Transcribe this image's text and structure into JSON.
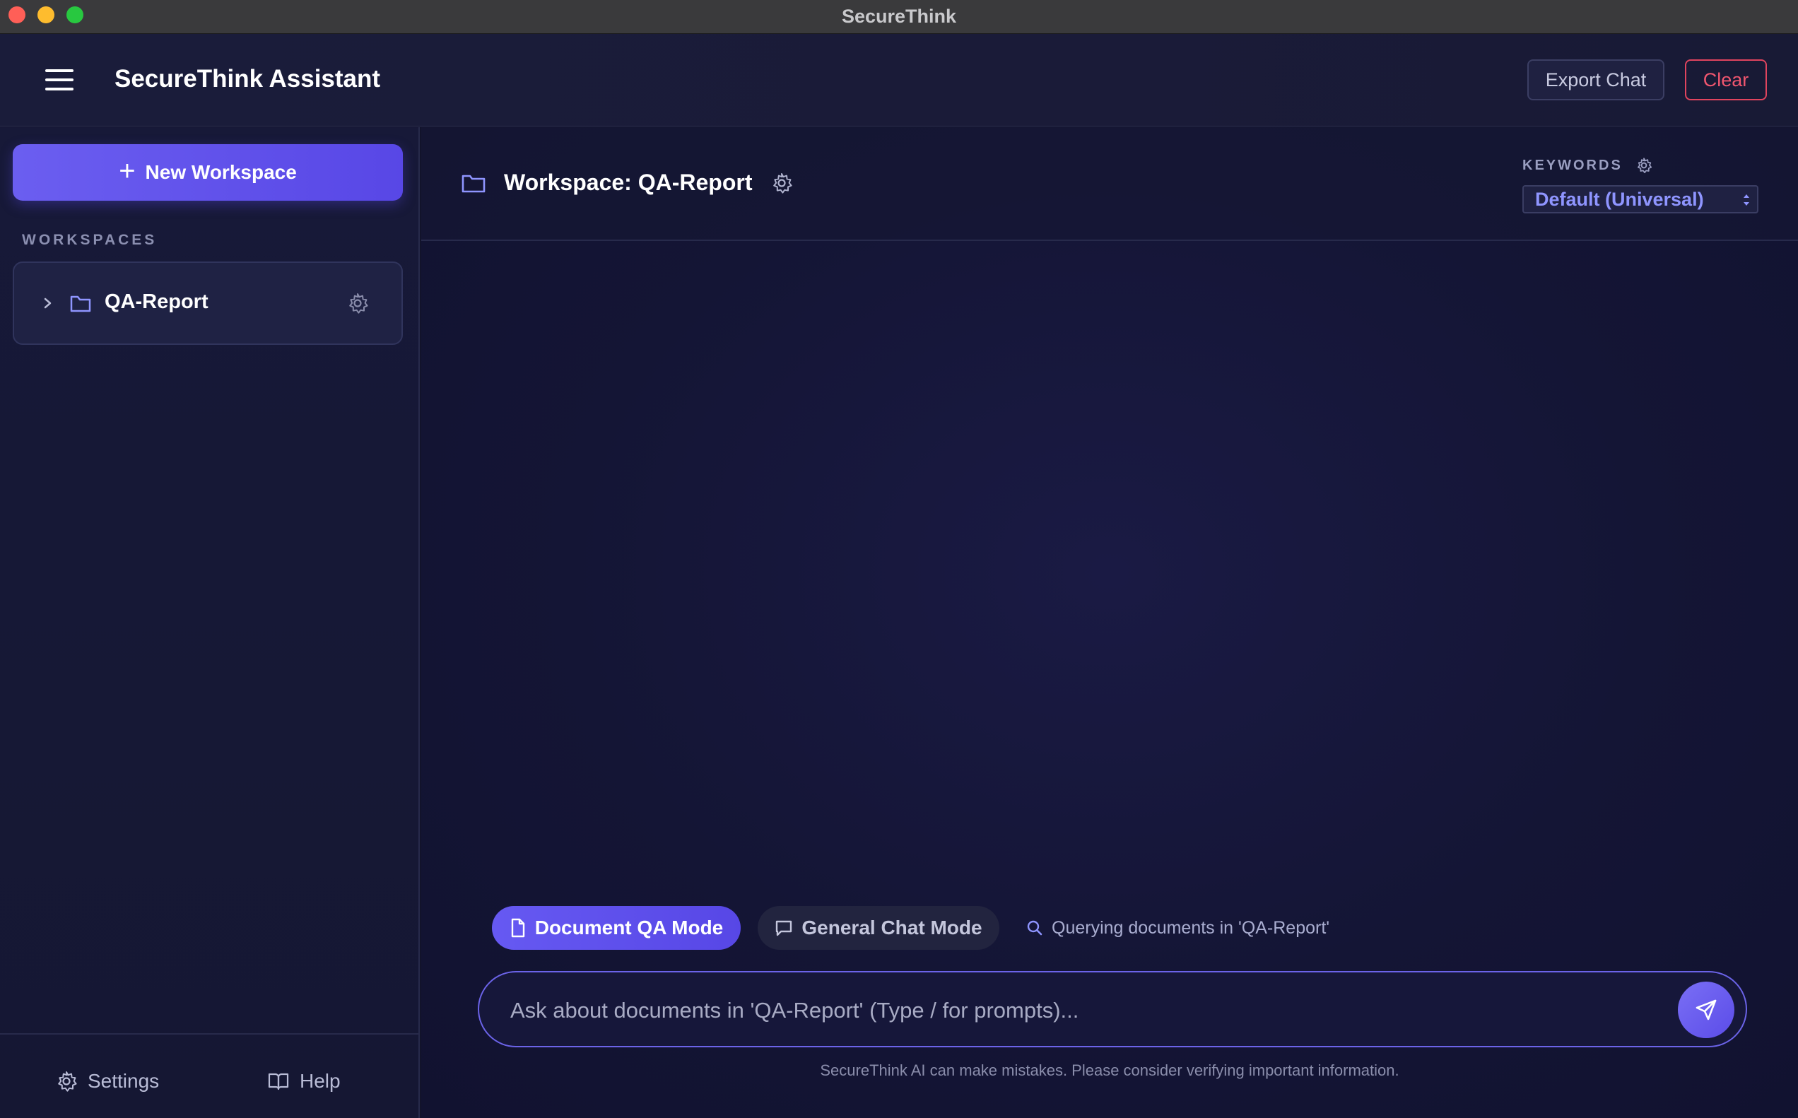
{
  "window": {
    "title": "SecureThink"
  },
  "header": {
    "title": "SecureThink Assistant",
    "export_label": "Export Chat",
    "clear_label": "Clear"
  },
  "sidebar": {
    "new_workspace_label": "New Workspace",
    "workspaces_heading": "WORKSPACES",
    "workspaces": [
      {
        "name": "QA-Report",
        "expanded": false
      }
    ],
    "footer": {
      "settings_label": "Settings",
      "help_label": "Help"
    }
  },
  "main": {
    "workspace_title": "Workspace: QA-Report",
    "keywords_label": "KEYWORDS",
    "keywords_selected": "Default (Universal)",
    "modes": {
      "active_label": "Document QA Mode",
      "inactive_label": "General Chat Mode",
      "status": "Querying documents in 'QA-Report'"
    },
    "input": {
      "placeholder": "Ask about documents in 'QA-Report' (Type / for prompts)...",
      "value": ""
    },
    "disclaimer": "SecureThink AI can make mistakes. Please consider verifying important information."
  },
  "colors": {
    "accent": "#5b4ce8",
    "danger": "#f0566f",
    "background": "#12132b"
  },
  "icons": [
    "menu-icon",
    "plus-icon",
    "chevron-right-icon",
    "folder-icon",
    "gear-icon",
    "book-icon",
    "document-icon",
    "chat-bubble-icon",
    "search-icon",
    "send-icon",
    "select-arrows-icon"
  ]
}
